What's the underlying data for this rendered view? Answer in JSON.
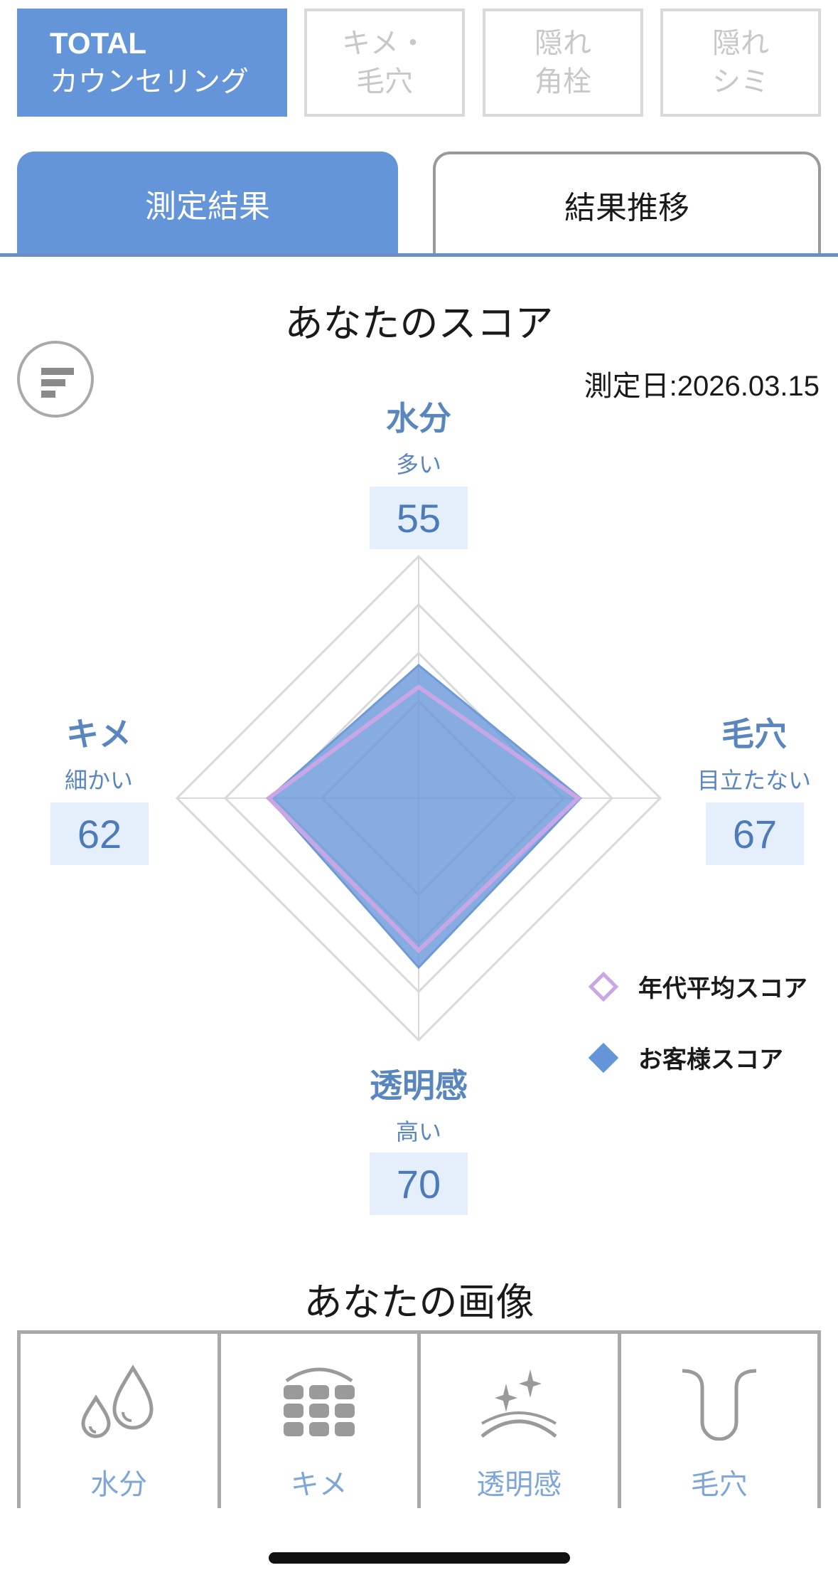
{
  "category_tabs": [
    {
      "line1": "TOTAL",
      "line2": "カウンセリング",
      "active": true
    },
    {
      "line1": "キメ・",
      "line2": "毛穴",
      "active": false
    },
    {
      "line1": "隠れ",
      "line2": "角栓",
      "active": false
    },
    {
      "line1": "隠れ",
      "line2": "シミ",
      "active": false
    }
  ],
  "result_tabs": {
    "active": "測定結果",
    "inactive": "結果推移"
  },
  "score_section": {
    "title": "あなたのスコア",
    "measure_date": "測定日:2026.03.15",
    "filter_icon": "filter-icon"
  },
  "axes": {
    "top": {
      "name": "水分",
      "sub": "多い",
      "score": "55"
    },
    "right": {
      "name": "毛穴",
      "sub": "目立たない",
      "score": "67"
    },
    "bottom": {
      "name": "透明感",
      "sub": "高い",
      "score": "70"
    },
    "left": {
      "name": "キメ",
      "sub": "細かい",
      "score": "62"
    }
  },
  "legend": {
    "average": "年代平均スコア",
    "customer": "お客様スコア"
  },
  "chart_data": {
    "type": "radar",
    "categories": [
      "水分",
      "毛穴",
      "透明感",
      "キメ"
    ],
    "series": [
      {
        "name": "お客様スコア",
        "values": [
          55,
          67,
          70,
          62
        ]
      },
      {
        "name": "年代平均スコア",
        "values": [
          46,
          66,
          63,
          62
        ]
      }
    ],
    "range": [
      0,
      100
    ],
    "colors": {
      "customer": "#6495d9",
      "average": "#c9a6e6",
      "grid": "#d9d9d9"
    }
  },
  "images_section": {
    "title": "あなたの画像",
    "tiles": [
      {
        "label": "水分",
        "icon": "water-drops-icon"
      },
      {
        "label": "キメ",
        "icon": "texture-grid-icon"
      },
      {
        "label": "透明感",
        "icon": "sparkle-icon"
      },
      {
        "label": "毛穴",
        "icon": "pore-icon"
      }
    ]
  }
}
